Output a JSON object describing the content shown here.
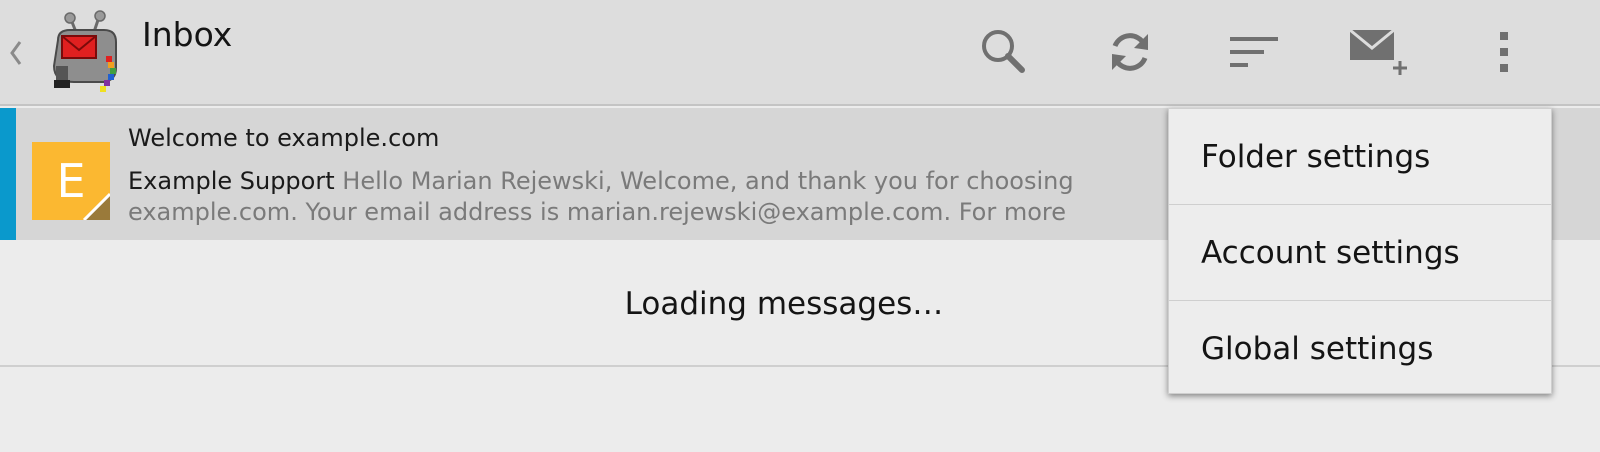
{
  "action_bar": {
    "title": "Inbox",
    "icons": [
      "up-caret-icon",
      "app-logo",
      "search-icon",
      "refresh-icon",
      "sort-icon",
      "compose-icon",
      "overflow-menu-icon"
    ]
  },
  "messages": [
    {
      "subject": "Welcome to example.com",
      "sender": "Example Support",
      "preview": "Hello Marian Rejewski, Welcome, and thank you for choosing example.com. Your email address is marian.rejewski@example.com. For more information on security please",
      "avatar_letter": "E",
      "unread": true
    }
  ],
  "loading_text": "Loading messages…",
  "overflow_menu": {
    "items": [
      {
        "label": "Folder settings"
      },
      {
        "label": "Account settings"
      },
      {
        "label": "Global settings"
      }
    ]
  },
  "colors": {
    "action_bar_bg": "#dddddd",
    "unread_strip": "#0a99cc",
    "avatar_bg": "#fbb831",
    "avatar_corner": "#9a7a3a",
    "preview_text": "#7a7a7a",
    "icon_gray": "#707070"
  }
}
